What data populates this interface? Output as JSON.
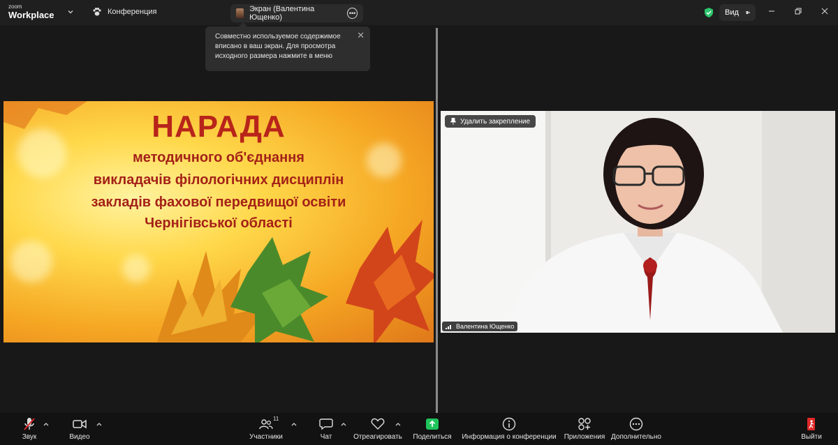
{
  "app": {
    "logo_small": "zoom",
    "logo_big": "Workplace"
  },
  "topbar": {
    "conference_label": "Конференция",
    "screen_tab_label": "Экран (Валентина Ющенко)",
    "view_label": "Вид",
    "shield_color": "#2cc36b"
  },
  "tooltip": {
    "line1": "Совместно используемое содержимое",
    "line2": "вписано в ваш экран. Для просмотра",
    "line3": "исходного размера нажмите в меню"
  },
  "slide": {
    "title": "НАРАДА",
    "line1": "методичного об'єднання",
    "line2": "викладачів філологічних дисциплін",
    "line3": "закладів фахової передвищої освіти",
    "line4": "Чернігівської області"
  },
  "video": {
    "unpin_label": "Удалить закрепление",
    "participant_name": "Валентина Ющенко"
  },
  "toolbar": {
    "audio_label": "Звук",
    "video_label": "Видео",
    "participants_label": "Участники",
    "participants_count": "11",
    "chat_label": "Чат",
    "react_label": "Отреагировать",
    "share_label": "Поделиться",
    "info_label": "Информация о конференции",
    "apps_label": "Приложения",
    "more_label": "Дополнительно",
    "leave_label": "Выйти",
    "share_color": "#1fc45b",
    "leave_color": "#e02828"
  }
}
